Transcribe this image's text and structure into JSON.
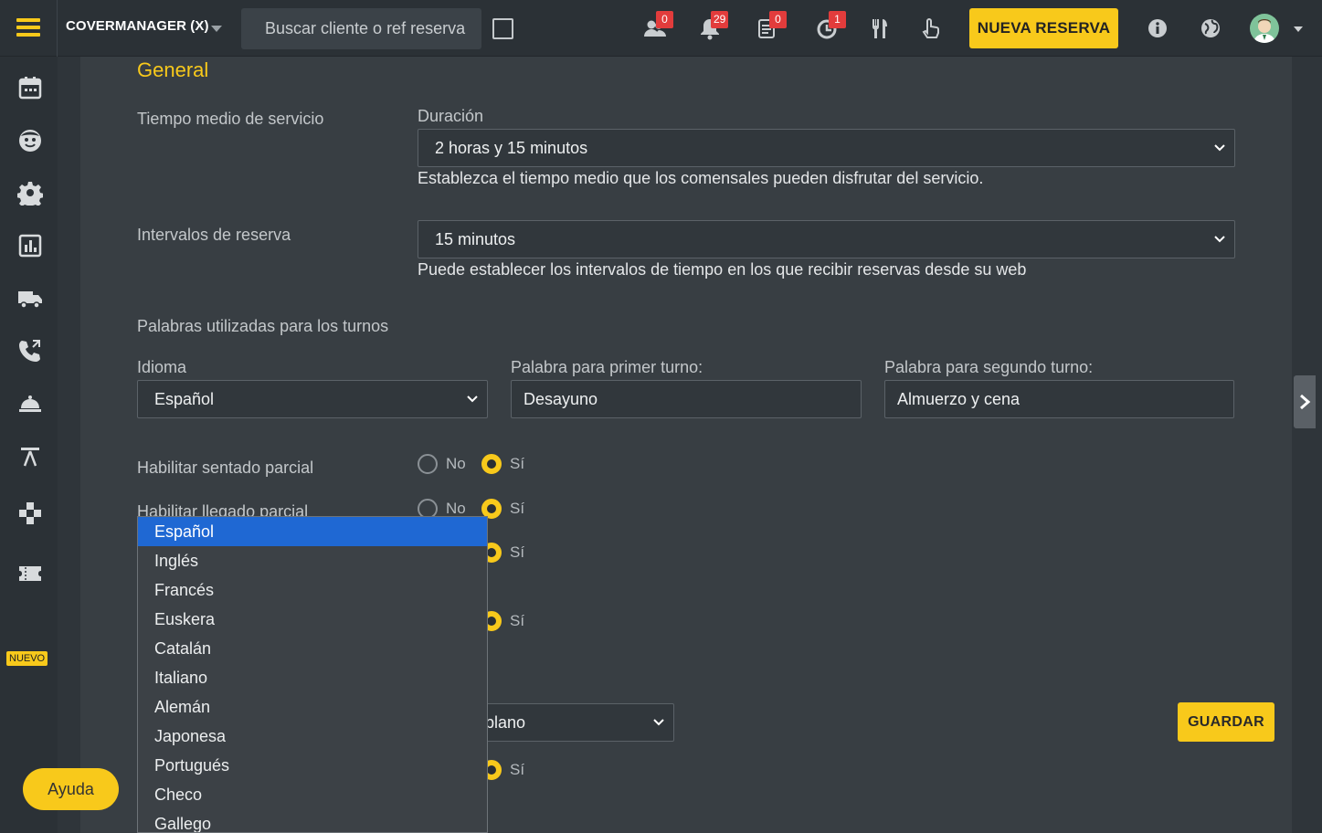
{
  "topbar": {
    "app_title": "COVERMANAGER (X)",
    "search_placeholder": "Buscar cliente o ref reserva",
    "badges": {
      "customers": "0",
      "notifications": "29",
      "list": "0",
      "timer": "1"
    },
    "new_reservation": "NUEVA RESERVA"
  },
  "sidebar": {
    "nuevo": "NUEVO",
    "help": "Ayuda"
  },
  "general": {
    "title": "General",
    "service_time_label": "Tiempo medio de servicio",
    "duration_label": "Duración",
    "duration_value": "2 horas y 15 minutos",
    "duration_help": "Establezca el tiempo medio que los comensales pueden disfrutar del servicio.",
    "intervals_label": "Intervalos de reserva",
    "intervals_value": "15 minutos",
    "intervals_help": "Puede establecer los intervalos de tiempo en los que recibir reservas desde su web",
    "shift_words_label": "Palabras utilizadas para los turnos",
    "language_label": "Idioma",
    "language_value": "Español",
    "first_shift_label": "Palabra para primer turno:",
    "first_shift_value": "Desayuno",
    "second_shift_label": "Palabra para segundo turno:",
    "second_shift_value": "Almuerzo y cena",
    "partial_seated_label": "Habilitar sentado parcial",
    "partial_arrival_label": "Habilitar llegado parcial",
    "no": "No",
    "yes": "Sí",
    "hidden_select_value": "plano",
    "save": "GUARDAR"
  },
  "language_options": [
    "Español",
    "Inglés",
    "Francés",
    "Euskera",
    "Catalán",
    "Italiano",
    "Alemán",
    "Japonesa",
    "Portugués",
    "Checo",
    "Gallego"
  ],
  "colors": {
    "accent": "#f8c91b",
    "selected": "#1f68d3",
    "badge": "#e23c3c"
  }
}
